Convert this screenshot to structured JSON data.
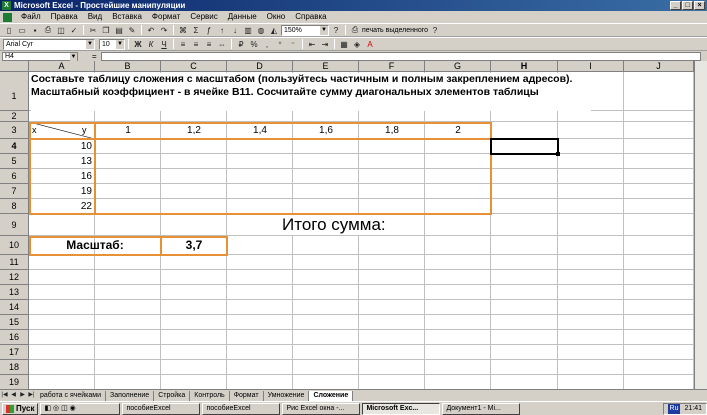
{
  "window": {
    "title": "Microsoft Excel - Простейшие манипуляции"
  },
  "menu": [
    "Файл",
    "Правка",
    "Вид",
    "Вставка",
    "Формат",
    "Сервис",
    "Данные",
    "Окно",
    "Справка"
  ],
  "toolbar": {
    "zoom": "150%",
    "print_selected": "печать выделенного",
    "font": "Arial Cyr",
    "size": "10"
  },
  "formula_bar": {
    "name_box": "H4",
    "equals": "=",
    "content": ""
  },
  "columns": [
    "A",
    "B",
    "C",
    "D",
    "E",
    "F",
    "G",
    "H",
    "I",
    "J"
  ],
  "rows": [
    "1",
    "2",
    "3",
    "4",
    "5",
    "6",
    "7",
    "8",
    "9",
    "10",
    "11",
    "12",
    "13",
    "14",
    "15",
    "16",
    "17",
    "18",
    "19"
  ],
  "sheet": {
    "instruction": "Составьте таблицу сложения с масштабом (пользуйтесь частичным и полным закреплением адресов). Масштабный коэффициент - в ячейке B11. Сосчитайте сумму диагональных элементов таблицы",
    "corner_x": "x",
    "corner_y": "y",
    "y_headers": [
      "1",
      "1,2",
      "1,4",
      "1,6",
      "1,8",
      "2"
    ],
    "x_values": [
      "10",
      "13",
      "16",
      "19",
      "22"
    ],
    "total_label": "Итого сумма:",
    "scale_label": "Масштаб:",
    "scale_value": "3,7"
  },
  "tabs": [
    "работа с ячейками",
    "Заполнение",
    "Стройка",
    "Контроль",
    "Формат",
    "Умножение",
    "Сложение"
  ],
  "active_tab": "Сложение",
  "taskbar": {
    "start": "Пуск",
    "tasks": [
      "пособиеExcel",
      "пособиеExcel",
      "Рис Excel окна -...",
      "Microsoft Exc...",
      "Документ1 - Mi..."
    ],
    "lang": "Ru",
    "clock": "21:41"
  }
}
